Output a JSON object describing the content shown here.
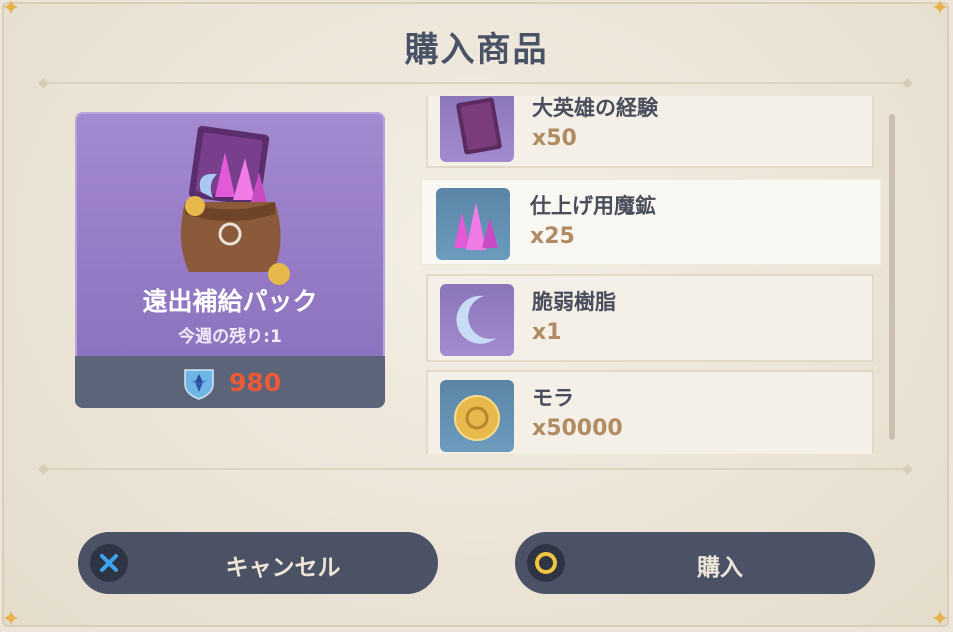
{
  "title": "購入商品",
  "pack": {
    "name": "遠出補給パック",
    "remaining": "今週の残り:1",
    "price": "980",
    "currency_icon": "primogem-icon"
  },
  "items": [
    {
      "name": "大英雄の経験",
      "qty": "x50",
      "icon": "book-icon"
    },
    {
      "name": "仕上げ用魔鉱",
      "qty": "x25",
      "icon": "crystal-icon"
    },
    {
      "name": "脆弱樹脂",
      "qty": "x1",
      "icon": "moon-resin-icon"
    },
    {
      "name": "モラ",
      "qty": "x50000",
      "icon": "mora-coin-icon"
    }
  ],
  "buttons": {
    "cancel": "キャンセル",
    "buy": "購入"
  },
  "colors": {
    "accent_price": "#ee5a36",
    "button_bg": "#4b5266",
    "cancel_icon": "#3ea6f0",
    "confirm_icon": "#f0c640"
  }
}
